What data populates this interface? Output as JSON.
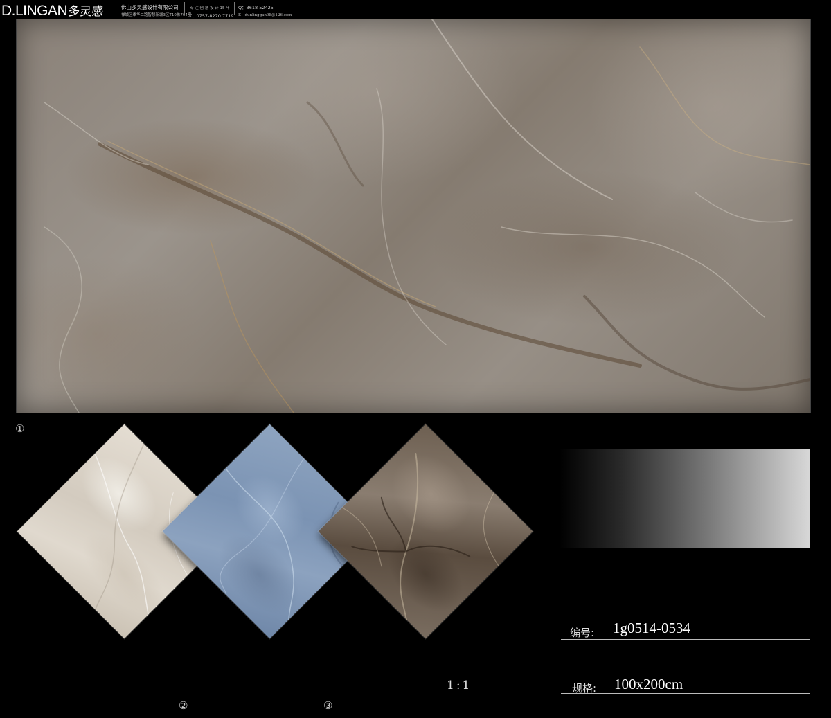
{
  "header": {
    "brand_en": "D.LINGAN",
    "brand_cn": "多灵感",
    "company": "佛山多灵感设计有限公司",
    "address": "禅城区季华二路智慧新城3区T10栋704室",
    "tagline": "专 注 创 意 设 计 15 年",
    "phone": "T：0757-8270 7719",
    "qq": "Q：3618 52425",
    "email": "E：dunlinggan98@126.com"
  },
  "markers": {
    "m1": "①",
    "m2": "②",
    "m3": "③",
    "ratio": "1:1"
  },
  "info": {
    "code_label": "编号:",
    "code_value": "1g0514-0534",
    "spec_label": "规格:",
    "spec_value": "100x200cm"
  },
  "colors": {
    "background": "#000000",
    "slab": "#8f877d",
    "tile_beige": "#dcd5ca",
    "tile_blue": "#8198b7",
    "tile_brown": "#6f6153"
  }
}
